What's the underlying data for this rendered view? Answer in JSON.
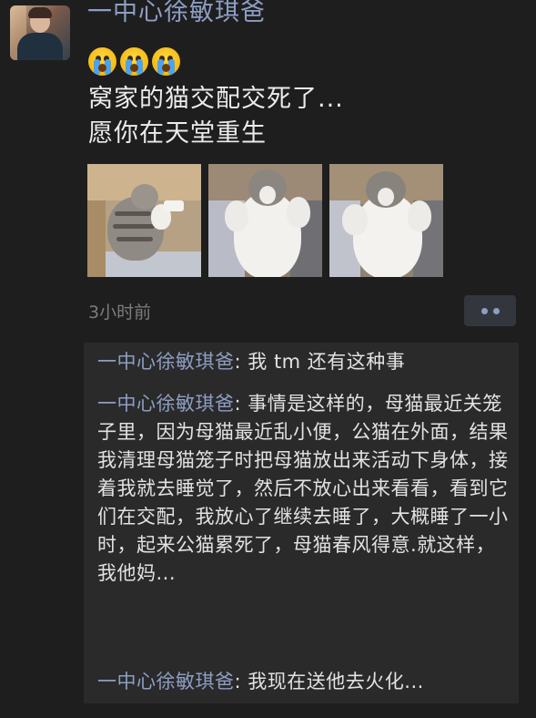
{
  "post": {
    "author": "一中心徐敏琪爸",
    "emoji_icons": [
      "crying-face-icon",
      "crying-face-icon",
      "crying-face-icon"
    ],
    "text_line1": "窝家的猫交配交死了...",
    "text_line2": "愿你在天堂重生",
    "photos": [
      "cat-photo-1",
      "cat-photo-2",
      "cat-photo-3"
    ],
    "time": "3小时前"
  },
  "comments": [
    {
      "name": "一中心徐敏琪爸",
      "sep": ": ",
      "text": "我 tm 还有这种事"
    },
    {
      "name": "一中心徐敏琪爸",
      "sep": ": ",
      "text": "事情是这样的，母猫最近关笼子里，因为母猫最近乱小便，公猫在外面，结果我清理母猫笼子时把母猫放出来活动下身体，接着我就去睡觉了，然后不放心出来看看，看到它们在交配，我放心了继续去睡了，大概睡了一小时，起来公猫累死了，母猫春风得意.就这样，我他妈..."
    },
    {
      "name": "一中心徐敏琪爸",
      "sep": ": ",
      "text": "我现在送他去火化..."
    }
  ],
  "colors": {
    "background": "#1e1e1e",
    "name_link": "#8d9ec4",
    "comment_bg": "#2a2a2a",
    "time_text": "#7c7c7c"
  }
}
